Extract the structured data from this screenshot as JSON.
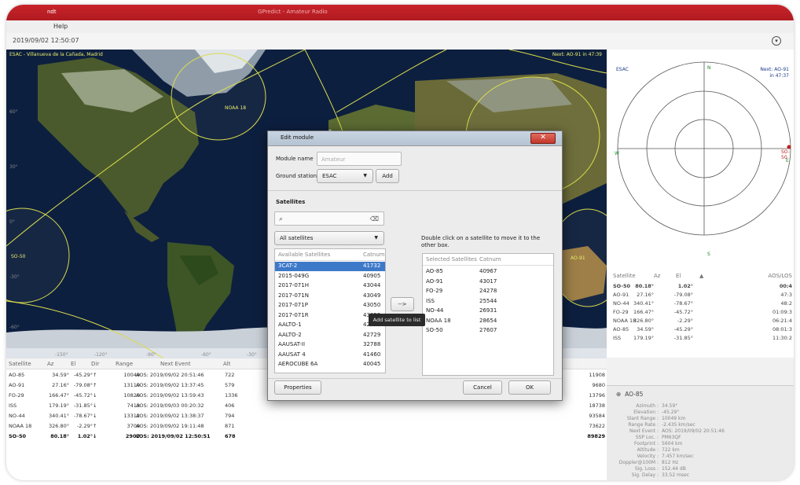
{
  "window": {
    "title_blurred": "GPredict - Amateur Radio",
    "menu_help": "Help",
    "clock": "2019/09/02 12:50:07",
    "menu_icon": "chevron-down-icon"
  },
  "map": {
    "ground_station_label": "ESAC - Villanueva de la Cañada, Madrid",
    "next_event": "Next: AO-91 in 47:39",
    "sat_labels": {
      "ao18": "NOAA 18",
      "left": "SO-50",
      "right": "AO-91"
    },
    "lat_ticks": [
      "60°",
      "30°",
      "0°",
      "-30°",
      "-60°"
    ],
    "lon_ticks": [
      "-150°",
      "-120°",
      "-90°",
      "-60°",
      "-30°"
    ]
  },
  "polar": {
    "station": "ESAC",
    "next": "Next: AO-91",
    "next2": "in 47:37",
    "n": "N",
    "s": "S",
    "e": "E",
    "w": "W",
    "sat": "SO-50"
  },
  "sat_table": {
    "headers": [
      "Satellite",
      "Az",
      "El",
      "▲",
      "AOS/LOS"
    ],
    "rows": [
      {
        "name": "SO-50",
        "az": "80.18°",
        "el": "1.02°",
        "aos": "00:4"
      },
      {
        "name": "AO-91",
        "az": "27.16°",
        "el": "-79.08°",
        "aos": "47:3"
      },
      {
        "name": "NO-44",
        "az": "340.41°",
        "el": "-78.67°",
        "aos": "48:2"
      },
      {
        "name": "FO-29",
        "az": "166.47°",
        "el": "-45.72°",
        "aos": "01:09:3"
      },
      {
        "name": "NOAA 18",
        "az": "326.80°",
        "el": "-2.29°",
        "aos": "06:21:4"
      },
      {
        "name": "AO-85",
        "az": "34.59°",
        "el": "-45.29°",
        "aos": "08:01:3"
      },
      {
        "name": "ISS",
        "az": "179.19°",
        "el": "-31.85°",
        "aos": "11:30:2"
      }
    ]
  },
  "bottom_table": {
    "headers": {
      "sat": "Satellite",
      "az": "Az",
      "el": "El",
      "dir": "Dir",
      "range": "Range",
      "next": "Next Event",
      "alt": "Alt"
    },
    "rows": [
      {
        "name": "AO-85",
        "az": "34.59°",
        "el": "-45.29°",
        "dir": "↑",
        "range": "10049",
        "next": "AOS: 2019/09/02 20:51:46",
        "alt": "722",
        "extra": "11908",
        "bold": false
      },
      {
        "name": "AO-91",
        "az": "27.16°",
        "el": "-79.08°",
        "dir": "↑",
        "range": "13110",
        "next": "AOS: 2019/09/02 13:37:45",
        "alt": "579",
        "extra": "9680",
        "bold": false
      },
      {
        "name": "FO-29",
        "az": "166.47°",
        "el": "-45.72°",
        "dir": "↓",
        "range": "10820",
        "next": "AOS: 2019/09/02 13:59:43",
        "alt": "1336",
        "extra": "13796",
        "bold": false
      },
      {
        "name": "ISS",
        "az": "179.19°",
        "el": "-31.85°",
        "dir": "↓",
        "range": "7413",
        "next": "AOS: 2019/09/03 00:20:32",
        "alt": "406",
        "extra": "18738",
        "bold": false
      },
      {
        "name": "NO-44",
        "az": "340.41°",
        "el": "-78.67°",
        "dir": "↓",
        "range": "13312",
        "next": "AOS: 2019/09/02 13:38:37",
        "alt": "794",
        "extra": "93584",
        "bold": false
      },
      {
        "name": "NOAA 18",
        "az": "326.80°",
        "el": "-2.29°",
        "dir": "↑",
        "range": "3709",
        "next": "AOS: 2019/09/02 19:11:48",
        "alt": "871",
        "extra": "73622",
        "bold": false
      },
      {
        "name": "SO-50",
        "az": "80.18°",
        "el": "1.02°",
        "dir": "↓",
        "range": "2907",
        "next": "LOS: 2019/09/02 12:50:51",
        "alt": "678",
        "extra": "89829",
        "bold": true
      }
    ]
  },
  "details": {
    "title": "AO-85",
    "lines": [
      {
        "k": "Azimuth :",
        "v": "34.59°"
      },
      {
        "k": "Elevation :",
        "v": "-45.29°"
      },
      {
        "k": "Slant Range :",
        "v": "10049 km"
      },
      {
        "k": "Range Rate :",
        "v": "-2.435 km/sec"
      },
      {
        "k": "Next Event :",
        "v": "AOS: 2019/09/02 20:51:46"
      },
      {
        "k": "SSP Loc. :",
        "v": "PM63QF"
      },
      {
        "k": "Footprint :",
        "v": "5604 km"
      },
      {
        "k": "Altitude :",
        "v": "722 km"
      },
      {
        "k": "Velocity :",
        "v": "7.457 km/sec"
      },
      {
        "k": "Doppler@100M :",
        "v": "812 Hz"
      },
      {
        "k": "Sig. Loss :",
        "v": "152.44 dB"
      },
      {
        "k": "Sig. Delay :",
        "v": "33.52 msec"
      }
    ]
  },
  "dialog": {
    "title": "Edit module",
    "module_name_label": "Module name",
    "module_name_placeholder": "Amateur",
    "ground_station_label": "Ground station",
    "ground_station_value": "ESAC",
    "add_label": "Add",
    "satellites_label": "Satellites",
    "filter_value": "All satellites",
    "available_headers": [
      "Available Satellites",
      "Catnum"
    ],
    "available": [
      {
        "name": "3CAT-2",
        "cat": "41732",
        "selected": true
      },
      {
        "name": "2015-049G",
        "cat": "40905"
      },
      {
        "name": "2017-071H",
        "cat": "43044"
      },
      {
        "name": "2017-071N",
        "cat": "43049"
      },
      {
        "name": "2017-071P",
        "cat": "43050"
      },
      {
        "name": "2017-071R",
        "cat": "43052"
      },
      {
        "name": "AALTO-1",
        "cat": "42775"
      },
      {
        "name": "AALTO-2",
        "cat": "42729"
      },
      {
        "name": "AAUSAT-II",
        "cat": "32788"
      },
      {
        "name": "AAUSAT 4",
        "cat": "41460"
      },
      {
        "name": "AEROCUBE 6A",
        "cat": "40045"
      }
    ],
    "hint": "Double click on a satellite to move it to the other box.",
    "move_label": "-->",
    "tooltip": "Add satellite to list",
    "selected_headers": [
      "Selected Satellites",
      "Catnum"
    ],
    "selected": [
      {
        "name": "AO-85",
        "cat": "40967"
      },
      {
        "name": "AO-91",
        "cat": "43017"
      },
      {
        "name": "FO-29",
        "cat": "24278"
      },
      {
        "name": "ISS",
        "cat": "25544"
      },
      {
        "name": "NO-44",
        "cat": "26931"
      },
      {
        "name": "NOAA 18",
        "cat": "28654"
      },
      {
        "name": "SO-50",
        "cat": "27607"
      }
    ],
    "properties_label": "Properties",
    "cancel_label": "Cancel",
    "ok_label": "OK"
  }
}
